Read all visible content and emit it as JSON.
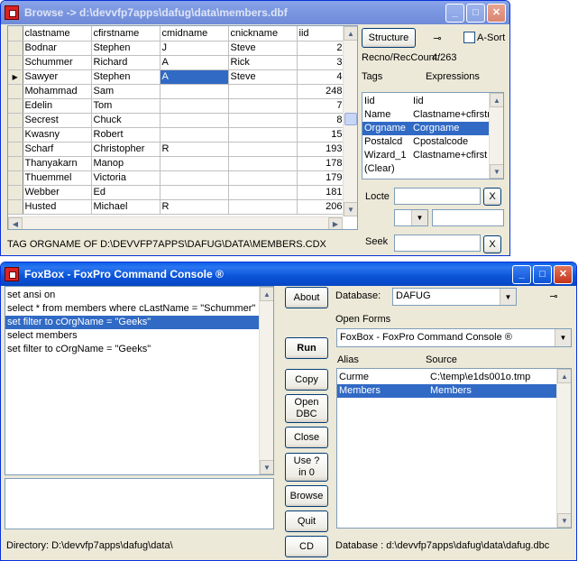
{
  "browse": {
    "title": "Browse -> d:\\devvfp7apps\\dafug\\data\\members.dbf",
    "columns": [
      "clastname",
      "cfirstname",
      "cmidname",
      "cnickname",
      "iid"
    ],
    "rows": [
      [
        "Bodnar",
        "Stephen",
        "J",
        "Steve",
        "2"
      ],
      [
        "Schummer",
        "Richard",
        "A",
        "Rick",
        "3"
      ],
      [
        "Sawyer",
        "Stephen",
        "A",
        "Steve",
        "4"
      ],
      [
        "Mohammad",
        "Sam",
        "",
        "",
        "248"
      ],
      [
        "Edelin",
        "Tom",
        "",
        "",
        "7"
      ],
      [
        "Secrest",
        "Chuck",
        "",
        "",
        "8"
      ],
      [
        "Kwasny",
        "Robert",
        "",
        "",
        "15"
      ],
      [
        "Scharf",
        "Christopher",
        "R",
        "",
        "193"
      ],
      [
        "Thanyakarn",
        "Manop",
        "",
        "",
        "178"
      ],
      [
        "Thuemmel",
        "Victoria",
        "",
        "",
        "179"
      ],
      [
        "Webber",
        "Ed",
        "",
        "",
        "181"
      ],
      [
        "Husted",
        "Michael",
        "R",
        "",
        "206"
      ]
    ],
    "current_row": 2,
    "structure_label": "Structure",
    "asort_label": "A-Sort",
    "recno_label": "Recno/RecCount:",
    "recno_value": "4/263",
    "tags_label": "Tags",
    "expressions_label": "Expressions",
    "tags": [
      {
        "tag": "Iid",
        "expr": "Iid"
      },
      {
        "tag": "Name",
        "expr": "Clastname+cfirstn"
      },
      {
        "tag": "Orgname",
        "expr": "Corgname"
      },
      {
        "tag": "Postalcd",
        "expr": "Cpostalcode"
      },
      {
        "tag": "Wizard_1",
        "expr": "Clastname+cfirst"
      },
      {
        "tag": "(Clear)",
        "expr": ""
      }
    ],
    "selected_tag": 2,
    "locate_label": "Locte",
    "seek_label": "Seek",
    "x_label": "X",
    "status": "TAG ORGNAME OF D:\\DEVVFP7APPS\\DAFUG\\DATA\\MEMBERS.CDX"
  },
  "foxbox": {
    "title": "FoxBox - FoxPro Command Console ®",
    "commands": [
      "set ansi on",
      "select * from members where cLastName = \"Schummer\" in",
      "set filter to cOrgName = \"Geeks\"",
      "select members",
      "set filter to cOrgName = \"Geeks\""
    ],
    "selected_command": 2,
    "buttons": {
      "about": "About",
      "run": "Run",
      "copy": "Copy",
      "open_dbc": "Open DBC",
      "close": "Close",
      "use_in_0": "Use ? in 0",
      "browse": "Browse",
      "quit": "Quit",
      "cd": "CD"
    },
    "database_label": "Database:",
    "database_value": "DAFUG",
    "open_forms_label": "Open Forms",
    "open_forms_value": "FoxBox - FoxPro Command Console ®",
    "alias_label": "Alias",
    "source_label": "Source",
    "aliases": [
      {
        "alias": "Curme",
        "source": "C:\\temp\\e1ds001o.tmp"
      },
      {
        "alias": "Members",
        "source": "Members"
      }
    ],
    "selected_alias": 1,
    "directory": "Directory: D:\\devvfp7apps\\dafug\\data\\",
    "database_path": "Database : d:\\devvfp7apps\\dafug\\data\\dafug.dbc"
  },
  "colors": {
    "selection": "#316ac5",
    "titlebar": "#0a5ee6",
    "face": "#ece9d8"
  }
}
